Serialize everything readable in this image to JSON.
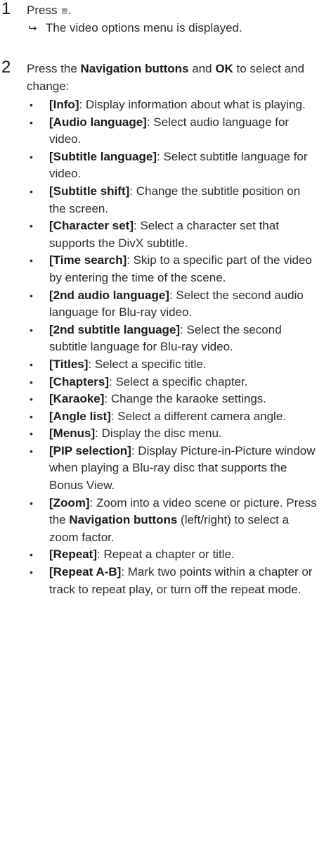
{
  "steps": [
    {
      "number": "1",
      "text_before_icon": "Press ",
      "icon": "menu-lines-icon",
      "icon_glyph": "≡",
      "text_after_icon": ".",
      "result_arrow_glyph": "↪",
      "result": "The video options menu is displayed."
    },
    {
      "number": "2",
      "intro_part1": "Press the ",
      "intro_strong1": "Navigation buttons",
      "intro_part2": " and ",
      "intro_strong2": "OK",
      "intro_part3": " to select and change:",
      "bullet_glyph": "•",
      "options": [
        {
          "name": "[Info]",
          "desc": ": Display information about what is playing."
        },
        {
          "name": "[Audio language]",
          "desc": ": Select audio language for video."
        },
        {
          "name": "[Subtitle language]",
          "desc": ": Select subtitle language for video."
        },
        {
          "name": "[Subtitle shift]",
          "desc": ": Change the subtitle position on the screen."
        },
        {
          "name": "[Character set]",
          "desc": ": Select a character set that supports the DivX subtitle."
        },
        {
          "name": "[Time search]",
          "desc": ": Skip to a specific part of the video by entering the time of the scene."
        },
        {
          "name": "[2nd audio language]",
          "desc": ": Select the second audio language for Blu-ray video."
        },
        {
          "name": "[2nd subtitle language]",
          "desc": ": Select the second subtitle language for Blu-ray video."
        },
        {
          "name": "[Titles]",
          "desc": ": Select a specific title."
        },
        {
          "name": "[Chapters]",
          "desc": ": Select a specific chapter."
        },
        {
          "name": "[Karaoke]",
          "desc": ": Change the karaoke settings."
        },
        {
          "name": "[Angle list]",
          "desc": ": Select a different camera angle."
        },
        {
          "name": "[Menus]",
          "desc": ": Display the disc menu."
        },
        {
          "name": "[PIP selection]",
          "desc": ": Display Picture-in-Picture window when playing a Blu-ray disc that supports the Bonus View."
        },
        {
          "name": "[Zoom]",
          "desc": ": Zoom into a video scene or picture. Press the ",
          "strong": "Navigation buttons",
          "desc_after": " (left/right) to select a zoom factor."
        },
        {
          "name": "[Repeat]",
          "desc": ": Repeat a chapter or title."
        },
        {
          "name": "[Repeat A-B]",
          "desc": ": Mark two points within a chapter or track to repeat play, or turn off the repeat mode."
        }
      ]
    }
  ]
}
